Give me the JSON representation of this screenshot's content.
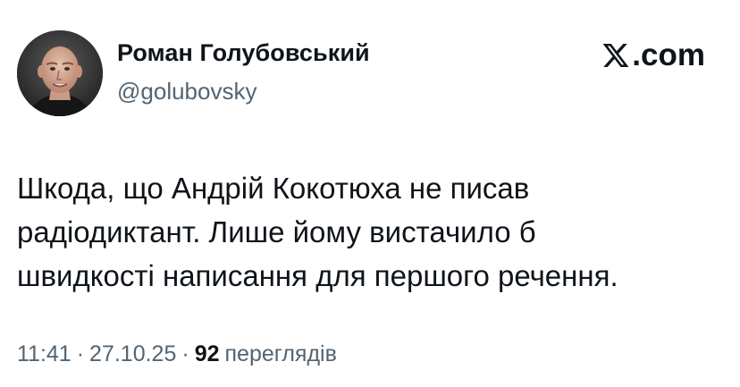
{
  "author": {
    "display_name": "Роман Голубовський",
    "handle": "@golubovsky"
  },
  "brand": {
    "label": ".com",
    "icon": "x-logo-icon"
  },
  "tweet": {
    "lines": [
      "Шкода, що Андрій Кокотюха не писав",
      "радіодиктант. Лише йому вистачило б",
      "швидкості написання для першого речення."
    ]
  },
  "meta": {
    "time": "11:41",
    "separator": "·",
    "date": "27.10.25",
    "views_count": "92",
    "views_label": "переглядів"
  },
  "colors": {
    "text_primary": "#0f1419",
    "text_secondary": "#536471",
    "background": "#ffffff"
  }
}
